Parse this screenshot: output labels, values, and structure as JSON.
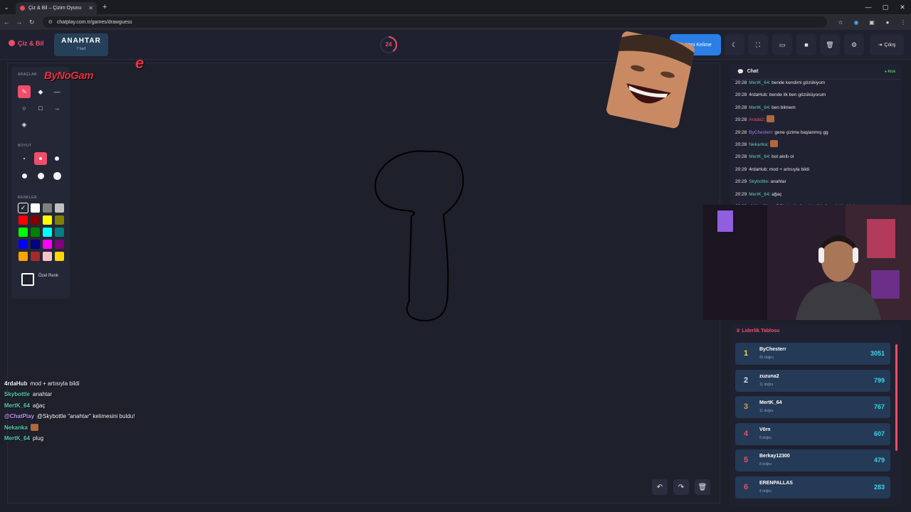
{
  "browser": {
    "tab_title": "Çiz & Bil – Çizim Oyunu",
    "url": "chatplay.com.tr/games/drawguess"
  },
  "header": {
    "logo": "Çiz & Bil",
    "word": "ANAHTAR",
    "word_hint": "7 harf",
    "timer": "24",
    "timer_fraction": 0.4,
    "new_word_label": "Yeni Kelime",
    "exit_label": "Çıkış"
  },
  "tools": {
    "section_tools": "ARAÇLAR",
    "section_size": "BOYUT",
    "section_colors": "RENKLER",
    "custom_color_label": "Özel Renk",
    "colors": [
      "#000000",
      "#ffffff",
      "#808080",
      "#c0c0c0",
      "#ff0000",
      "#800000",
      "#ffff00",
      "#808000",
      "#00ff00",
      "#008000",
      "#00ffff",
      "#008080",
      "#0000ff",
      "#000080",
      "#ff00ff",
      "#800080",
      "#ffa500",
      "#a52a2a",
      "#ffc0cb",
      "#ffd700"
    ]
  },
  "overlay": {
    "watermark": "ByNoGam",
    "watermark_suffix": "e",
    "chat": [
      {
        "user": "4rdaHub",
        "color": "#ffffff",
        "text": "mod + artısıyla bildi"
      },
      {
        "user": "Skybottle",
        "color": "#5ad1b6",
        "text": "anahtar"
      },
      {
        "user": "MertK_64",
        "color": "#5ad1b6",
        "text": "ağaç"
      },
      {
        "user": "@ChatPlay",
        "color": "#c49bff",
        "text": "@Skybottle \"anahtar\" kelimesini buldu!"
      },
      {
        "user": "Nekanka",
        "color": "#5ad1b6",
        "text": ""
      },
      {
        "user": "MertK_64",
        "color": "#5ad1b6",
        "text": "plug"
      }
    ]
  },
  "chat": {
    "title": "Chat",
    "status": "Kick",
    "messages": [
      {
        "time": "20:28",
        "user": "MertK_64",
        "color": "#5ad1b6",
        "text": "bende kendimi gözükiyom"
      },
      {
        "time": "20:28",
        "user": "4rdaHub",
        "color": "#e6e6e6",
        "text": "bende ilk ben gözüküyorum"
      },
      {
        "time": "20:28",
        "user": "MertK_64",
        "color": "#5ad1b6",
        "text": "ben bilmem"
      },
      {
        "time": "20:28",
        "user": "Arada2",
        "color": "#ef4d6a",
        "text": ""
      },
      {
        "time": "20:28",
        "user": "ByChesterr",
        "color": "#a77cff",
        "text": "gene çizime başlanmış gg"
      },
      {
        "time": "20:28",
        "user": "Nekanka",
        "color": "#5ad1b6",
        "text": ""
      },
      {
        "time": "20:28",
        "user": "MertK_64",
        "color": "#5ad1b6",
        "text": "bot akıllı ol"
      },
      {
        "time": "20:29",
        "user": "4rdaHub",
        "color": "#e6e6e6",
        "text": "mod + artısıyla bildi"
      },
      {
        "time": "20:29",
        "user": "Skybottle",
        "color": "#5ad1b6",
        "text": "anahtar"
      },
      {
        "time": "20:29",
        "user": "MertK_64",
        "color": "#5ad1b6",
        "text": "ağaç"
      },
      {
        "time": "20:29",
        "user": "@ChatPlay",
        "color": "#a77cff",
        "text": "@Skybottle \"anahtar\" kelimesini buldu!"
      }
    ]
  },
  "leaderboard": {
    "title": "Liderlik Tablosu",
    "rows": [
      {
        "rank": "1",
        "name": "ByChesterr",
        "sub": "45 doğru",
        "score": "3051",
        "rank_color": "#ffd43b"
      },
      {
        "rank": "2",
        "name": "zuzuna2",
        "sub": "11 doğru",
        "score": "799",
        "rank_color": "#d9dde6"
      },
      {
        "rank": "3",
        "name": "MertK_64",
        "sub": "11 doğru",
        "score": "767",
        "rank_color": "#e09a4a"
      },
      {
        "rank": "4",
        "name": "V0rn",
        "sub": "9 doğru",
        "score": "607",
        "rank_color": "#ef4d6a"
      },
      {
        "rank": "5",
        "name": "Berkay12300",
        "sub": "8 doğru",
        "score": "479",
        "rank_color": "#ef4d6a"
      },
      {
        "rank": "6",
        "name": "ERENPALLAS",
        "sub": "4 doğru",
        "score": "283",
        "rank_color": "#ef4d6a"
      }
    ]
  }
}
